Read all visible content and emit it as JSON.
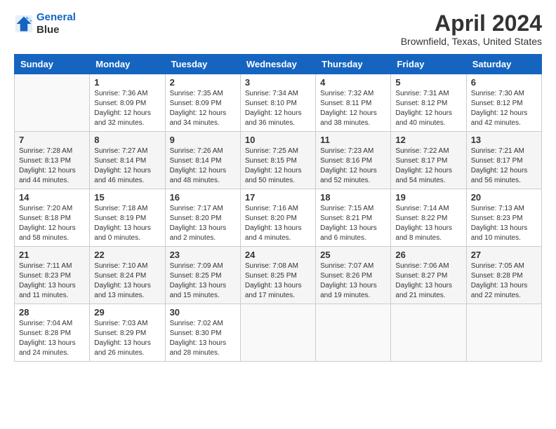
{
  "header": {
    "logo_line1": "General",
    "logo_line2": "Blue",
    "month_title": "April 2024",
    "location": "Brownfield, Texas, United States"
  },
  "days_of_week": [
    "Sunday",
    "Monday",
    "Tuesday",
    "Wednesday",
    "Thursday",
    "Friday",
    "Saturday"
  ],
  "weeks": [
    [
      {
        "day": "",
        "sunrise": "",
        "sunset": "",
        "daylight": ""
      },
      {
        "day": "1",
        "sunrise": "Sunrise: 7:36 AM",
        "sunset": "Sunset: 8:09 PM",
        "daylight": "Daylight: 12 hours and 32 minutes."
      },
      {
        "day": "2",
        "sunrise": "Sunrise: 7:35 AM",
        "sunset": "Sunset: 8:09 PM",
        "daylight": "Daylight: 12 hours and 34 minutes."
      },
      {
        "day": "3",
        "sunrise": "Sunrise: 7:34 AM",
        "sunset": "Sunset: 8:10 PM",
        "daylight": "Daylight: 12 hours and 36 minutes."
      },
      {
        "day": "4",
        "sunrise": "Sunrise: 7:32 AM",
        "sunset": "Sunset: 8:11 PM",
        "daylight": "Daylight: 12 hours and 38 minutes."
      },
      {
        "day": "5",
        "sunrise": "Sunrise: 7:31 AM",
        "sunset": "Sunset: 8:12 PM",
        "daylight": "Daylight: 12 hours and 40 minutes."
      },
      {
        "day": "6",
        "sunrise": "Sunrise: 7:30 AM",
        "sunset": "Sunset: 8:12 PM",
        "daylight": "Daylight: 12 hours and 42 minutes."
      }
    ],
    [
      {
        "day": "7",
        "sunrise": "Sunrise: 7:28 AM",
        "sunset": "Sunset: 8:13 PM",
        "daylight": "Daylight: 12 hours and 44 minutes."
      },
      {
        "day": "8",
        "sunrise": "Sunrise: 7:27 AM",
        "sunset": "Sunset: 8:14 PM",
        "daylight": "Daylight: 12 hours and 46 minutes."
      },
      {
        "day": "9",
        "sunrise": "Sunrise: 7:26 AM",
        "sunset": "Sunset: 8:14 PM",
        "daylight": "Daylight: 12 hours and 48 minutes."
      },
      {
        "day": "10",
        "sunrise": "Sunrise: 7:25 AM",
        "sunset": "Sunset: 8:15 PM",
        "daylight": "Daylight: 12 hours and 50 minutes."
      },
      {
        "day": "11",
        "sunrise": "Sunrise: 7:23 AM",
        "sunset": "Sunset: 8:16 PM",
        "daylight": "Daylight: 12 hours and 52 minutes."
      },
      {
        "day": "12",
        "sunrise": "Sunrise: 7:22 AM",
        "sunset": "Sunset: 8:17 PM",
        "daylight": "Daylight: 12 hours and 54 minutes."
      },
      {
        "day": "13",
        "sunrise": "Sunrise: 7:21 AM",
        "sunset": "Sunset: 8:17 PM",
        "daylight": "Daylight: 12 hours and 56 minutes."
      }
    ],
    [
      {
        "day": "14",
        "sunrise": "Sunrise: 7:20 AM",
        "sunset": "Sunset: 8:18 PM",
        "daylight": "Daylight: 12 hours and 58 minutes."
      },
      {
        "day": "15",
        "sunrise": "Sunrise: 7:18 AM",
        "sunset": "Sunset: 8:19 PM",
        "daylight": "Daylight: 13 hours and 0 minutes."
      },
      {
        "day": "16",
        "sunrise": "Sunrise: 7:17 AM",
        "sunset": "Sunset: 8:20 PM",
        "daylight": "Daylight: 13 hours and 2 minutes."
      },
      {
        "day": "17",
        "sunrise": "Sunrise: 7:16 AM",
        "sunset": "Sunset: 8:20 PM",
        "daylight": "Daylight: 13 hours and 4 minutes."
      },
      {
        "day": "18",
        "sunrise": "Sunrise: 7:15 AM",
        "sunset": "Sunset: 8:21 PM",
        "daylight": "Daylight: 13 hours and 6 minutes."
      },
      {
        "day": "19",
        "sunrise": "Sunrise: 7:14 AM",
        "sunset": "Sunset: 8:22 PM",
        "daylight": "Daylight: 13 hours and 8 minutes."
      },
      {
        "day": "20",
        "sunrise": "Sunrise: 7:13 AM",
        "sunset": "Sunset: 8:23 PM",
        "daylight": "Daylight: 13 hours and 10 minutes."
      }
    ],
    [
      {
        "day": "21",
        "sunrise": "Sunrise: 7:11 AM",
        "sunset": "Sunset: 8:23 PM",
        "daylight": "Daylight: 13 hours and 11 minutes."
      },
      {
        "day": "22",
        "sunrise": "Sunrise: 7:10 AM",
        "sunset": "Sunset: 8:24 PM",
        "daylight": "Daylight: 13 hours and 13 minutes."
      },
      {
        "day": "23",
        "sunrise": "Sunrise: 7:09 AM",
        "sunset": "Sunset: 8:25 PM",
        "daylight": "Daylight: 13 hours and 15 minutes."
      },
      {
        "day": "24",
        "sunrise": "Sunrise: 7:08 AM",
        "sunset": "Sunset: 8:25 PM",
        "daylight": "Daylight: 13 hours and 17 minutes."
      },
      {
        "day": "25",
        "sunrise": "Sunrise: 7:07 AM",
        "sunset": "Sunset: 8:26 PM",
        "daylight": "Daylight: 13 hours and 19 minutes."
      },
      {
        "day": "26",
        "sunrise": "Sunrise: 7:06 AM",
        "sunset": "Sunset: 8:27 PM",
        "daylight": "Daylight: 13 hours and 21 minutes."
      },
      {
        "day": "27",
        "sunrise": "Sunrise: 7:05 AM",
        "sunset": "Sunset: 8:28 PM",
        "daylight": "Daylight: 13 hours and 22 minutes."
      }
    ],
    [
      {
        "day": "28",
        "sunrise": "Sunrise: 7:04 AM",
        "sunset": "Sunset: 8:28 PM",
        "daylight": "Daylight: 13 hours and 24 minutes."
      },
      {
        "day": "29",
        "sunrise": "Sunrise: 7:03 AM",
        "sunset": "Sunset: 8:29 PM",
        "daylight": "Daylight: 13 hours and 26 minutes."
      },
      {
        "day": "30",
        "sunrise": "Sunrise: 7:02 AM",
        "sunset": "Sunset: 8:30 PM",
        "daylight": "Daylight: 13 hours and 28 minutes."
      },
      {
        "day": "",
        "sunrise": "",
        "sunset": "",
        "daylight": ""
      },
      {
        "day": "",
        "sunrise": "",
        "sunset": "",
        "daylight": ""
      },
      {
        "day": "",
        "sunrise": "",
        "sunset": "",
        "daylight": ""
      },
      {
        "day": "",
        "sunrise": "",
        "sunset": "",
        "daylight": ""
      }
    ]
  ]
}
